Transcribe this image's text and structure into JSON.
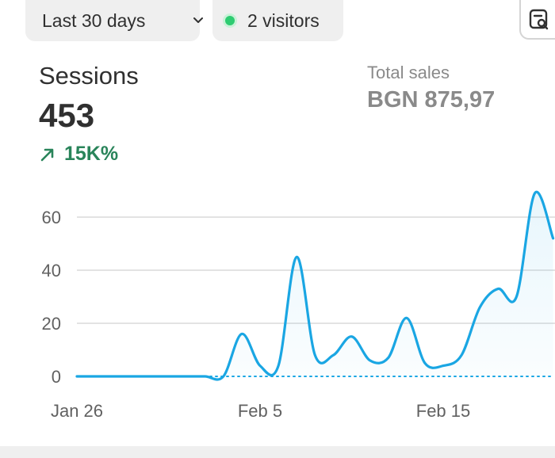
{
  "filters": {
    "date_range_label": "Last 30 days",
    "visitors_label": "2 visitors"
  },
  "icons": {
    "date_chevron": "chevron-down-icon",
    "live_dot": "live-status-dot-icon",
    "report": "report-search-icon",
    "trend": "arrow-up-right-icon"
  },
  "metrics": {
    "sessions_title": "Sessions",
    "sessions_value": "453",
    "sessions_change": "15K%",
    "sales_title": "Total sales",
    "sales_value": "BGN 875,97"
  },
  "colors": {
    "line": "#1aa6e3",
    "positive": "#29845a",
    "muted": "#8a8a8a",
    "live_dot": "#2ecc71"
  },
  "chart_data": {
    "type": "area",
    "x_tick_labels": [
      "Jan 26",
      "Feb 5",
      "Feb 15"
    ],
    "y_tick_labels": [
      "0",
      "20",
      "40",
      "60"
    ],
    "ylim": [
      0,
      70
    ],
    "grid": true,
    "series": [
      {
        "values": [
          0,
          0,
          0,
          0,
          0,
          0,
          0,
          0,
          0,
          16,
          4,
          4,
          45,
          8,
          8,
          15,
          6,
          7,
          22,
          5,
          4,
          8,
          26,
          33,
          30,
          69,
          52
        ],
        "style": "solid"
      },
      {
        "values": [
          0,
          0,
          0,
          0,
          0,
          0,
          0,
          0,
          0,
          0,
          0,
          0,
          0,
          0,
          0,
          0,
          0,
          0,
          0,
          0,
          0,
          0,
          0,
          0,
          0,
          0,
          0
        ],
        "style": "dotted"
      }
    ]
  }
}
